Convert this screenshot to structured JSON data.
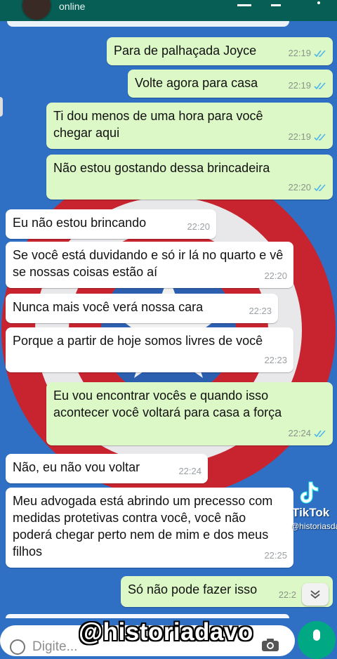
{
  "header": {
    "status": "online"
  },
  "messages": [
    {
      "dir": "out",
      "text": "Para de palhaçada Joyce",
      "time": "22:19",
      "read": true
    },
    {
      "dir": "out",
      "text": "Volte agora para casa",
      "time": "22:19",
      "read": true
    },
    {
      "dir": "out",
      "text": "Ti dou menos de uma hora para você chegar aqui",
      "time": "22:19",
      "read": true
    },
    {
      "dir": "out",
      "text": "Não estou gostando dessa brincadeira",
      "time": "22:20",
      "read": true
    },
    {
      "dir": "in",
      "text": "Eu não estou brincando",
      "time": "22:20"
    },
    {
      "dir": "in",
      "text": "Se você está duvidando e só ir lá no quarto e vê se nossas coisas estão aí",
      "time": "22:20"
    },
    {
      "dir": "in",
      "text": "Nunca mais você verá nossa cara",
      "time": "22:23"
    },
    {
      "dir": "in",
      "text": "Porque a partir de hoje somos livres de você",
      "time": "22:23"
    },
    {
      "dir": "out",
      "text": "Eu vou encontrar vocês e quando isso acontecer você voltará para casa a força",
      "time": "22:24",
      "read": true
    },
    {
      "dir": "in",
      "text": "Não, eu não vou voltar",
      "time": "22:24"
    },
    {
      "dir": "in",
      "text": "Meu advogada está abrindo um precesso com medidas protetivas contra você, você não poderá chegar perto nem de mim e dos meus filhos",
      "time": "22:25"
    },
    {
      "dir": "out",
      "text": "Só não pode fazer isso",
      "time": "22:2",
      "read": false
    }
  ],
  "watermark": {
    "brand": "TikTok",
    "handle": "@historiasdavo"
  },
  "input": {
    "placeholder": "Digite..."
  },
  "overlay": {
    "handle": "@historiadavo"
  },
  "colors": {
    "outgoing": "#dcf8c6",
    "incoming": "#ffffff",
    "read_ticks": "#4fb6ec",
    "header": "#075e54",
    "mic": "#00a884"
  },
  "icons": {
    "scroll": "chevron-down-icon",
    "camera": "camera-icon",
    "mic": "mic-icon",
    "emoji": "emoji-icon"
  }
}
